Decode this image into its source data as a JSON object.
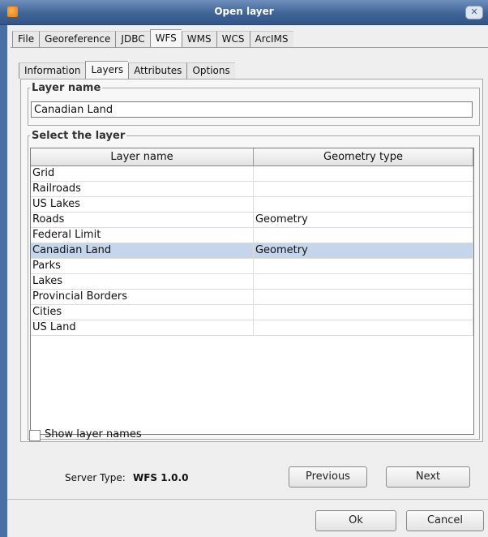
{
  "window": {
    "title": "Open layer",
    "app_icon": "app-icon",
    "close_icon": "close-icon"
  },
  "main_tabs": [
    {
      "label": "File",
      "active": false
    },
    {
      "label": "Georeference",
      "active": false
    },
    {
      "label": "JDBC",
      "active": false
    },
    {
      "label": "WFS",
      "active": true
    },
    {
      "label": "WMS",
      "active": false
    },
    {
      "label": "WCS",
      "active": false
    },
    {
      "label": "ArcIMS",
      "active": false
    }
  ],
  "sub_tabs": [
    {
      "label": "Information",
      "active": false
    },
    {
      "label": "Layers",
      "active": true
    },
    {
      "label": "Attributes",
      "active": false
    },
    {
      "label": "Options",
      "active": false
    }
  ],
  "layer_name_group": {
    "legend": "Layer name",
    "value": "Canadian Land"
  },
  "select_layer_group": {
    "legend": "Select the layer",
    "columns": [
      "Layer name",
      "Geometry type"
    ],
    "rows": [
      {
        "name": "Grid",
        "geometry": ""
      },
      {
        "name": "Railroads",
        "geometry": ""
      },
      {
        "name": "US Lakes",
        "geometry": ""
      },
      {
        "name": "Roads",
        "geometry": "Geometry"
      },
      {
        "name": "Federal Limit",
        "geometry": ""
      },
      {
        "name": "Canadian Land",
        "geometry": "Geometry",
        "selected": true
      },
      {
        "name": "Parks",
        "geometry": ""
      },
      {
        "name": "Lakes",
        "geometry": ""
      },
      {
        "name": "Provincial Borders",
        "geometry": ""
      },
      {
        "name": "Cities",
        "geometry": ""
      },
      {
        "name": "US Land",
        "geometry": ""
      }
    ]
  },
  "show_layer_names": {
    "label": "Show layer names",
    "checked": false
  },
  "server": {
    "label": "Server Type:",
    "value": "WFS 1.0.0"
  },
  "nav": {
    "previous": "Previous",
    "next": "Next"
  },
  "dialog": {
    "ok": "Ok",
    "cancel": "Cancel"
  },
  "colors": {
    "titlebar": "#3f6496",
    "selection": "#c5d5ea",
    "frame": "#4a6fa5"
  }
}
